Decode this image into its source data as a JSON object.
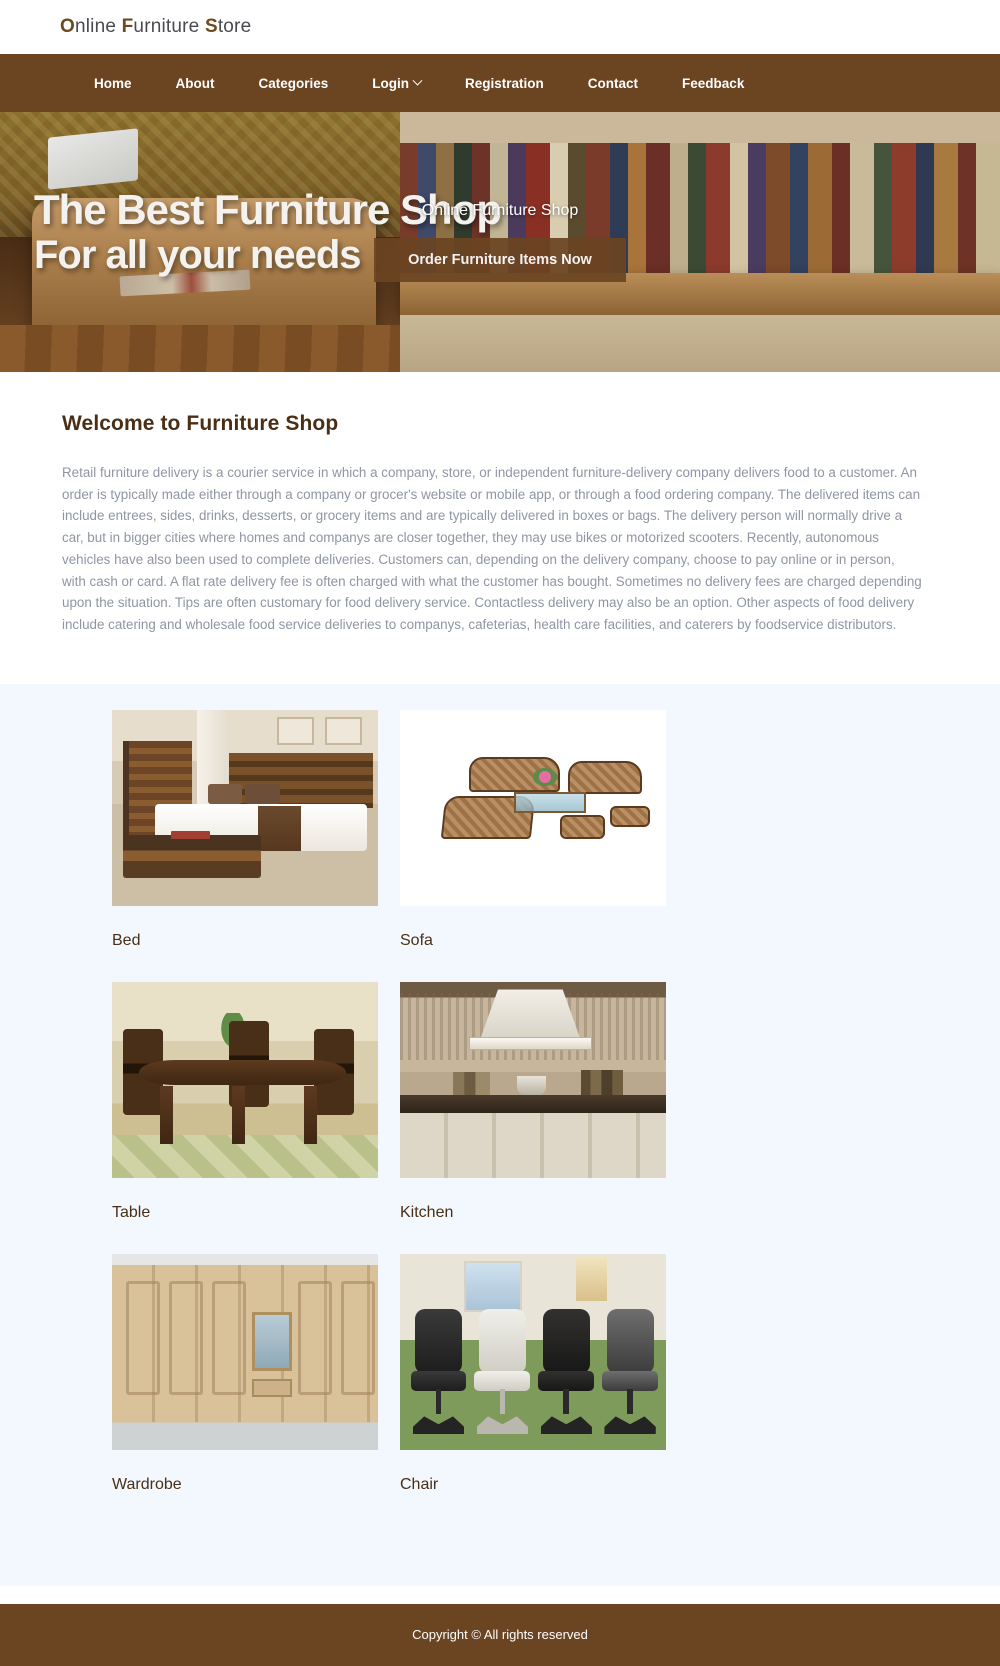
{
  "header": {
    "logo_full": "Online Furniture Store",
    "logo_parts": [
      {
        "cap": "O",
        "rest": "nline "
      },
      {
        "cap": "F",
        "rest": "urniture "
      },
      {
        "cap": "S",
        "rest": "tore"
      }
    ]
  },
  "nav": {
    "items": [
      {
        "label": "Home",
        "has_dropdown": false
      },
      {
        "label": "About",
        "has_dropdown": false
      },
      {
        "label": "Categories",
        "has_dropdown": false
      },
      {
        "label": "Login",
        "has_dropdown": true
      },
      {
        "label": "Registration",
        "has_dropdown": false
      },
      {
        "label": "Contact",
        "has_dropdown": false
      },
      {
        "label": "Feedback",
        "has_dropdown": false
      }
    ]
  },
  "hero": {
    "banner_headline_line1": "The Best Furniture Shop",
    "banner_headline_line2": "For all your needs",
    "title": "Online Furniture Shop",
    "button_label": "Order Furniture Items Now"
  },
  "welcome": {
    "heading": "Welcome to Furniture Shop",
    "body": "Retail furniture delivery is a courier service in which a company, store, or independent furniture-delivery company delivers food to a customer. An order is typically made either through a company or grocer's website or mobile app, or through a food ordering company. The delivered items can include entrees, sides, drinks, desserts, or grocery items and are typically delivered in boxes or bags. The delivery person will normally drive a car, but in bigger cities where homes and companys are closer together, they may use bikes or motorized scooters. Recently, autonomous vehicles have also been used to complete deliveries. Customers can, depending on the delivery company, choose to pay online or in person, with cash or card. A flat rate delivery fee is often charged with what the customer has bought. Sometimes no delivery fees are charged depending upon the situation. Tips are often customary for food delivery service. Contactless delivery may also be an option. Other aspects of food delivery include catering and wholesale food service deliveries to companys, cafeterias, health care facilities, and caterers by foodservice distributors."
  },
  "products": {
    "items": [
      {
        "label": "Bed",
        "art": "art-bed"
      },
      {
        "label": "Sofa",
        "art": "art-sofa"
      },
      {
        "label": "Table",
        "art": "art-table"
      },
      {
        "label": "Kitchen",
        "art": "art-kitchen"
      },
      {
        "label": "Wardrobe",
        "art": "art-wardrobe"
      },
      {
        "label": "Chair",
        "art": "art-chair"
      }
    ]
  },
  "footer": {
    "copyright": "Copyright © All rights reserved"
  },
  "colors": {
    "brand_brown": "#6b4422",
    "heading_brown": "#4a2f16",
    "body_gray": "#8f95a3",
    "section_bg": "#f2f8fd"
  }
}
